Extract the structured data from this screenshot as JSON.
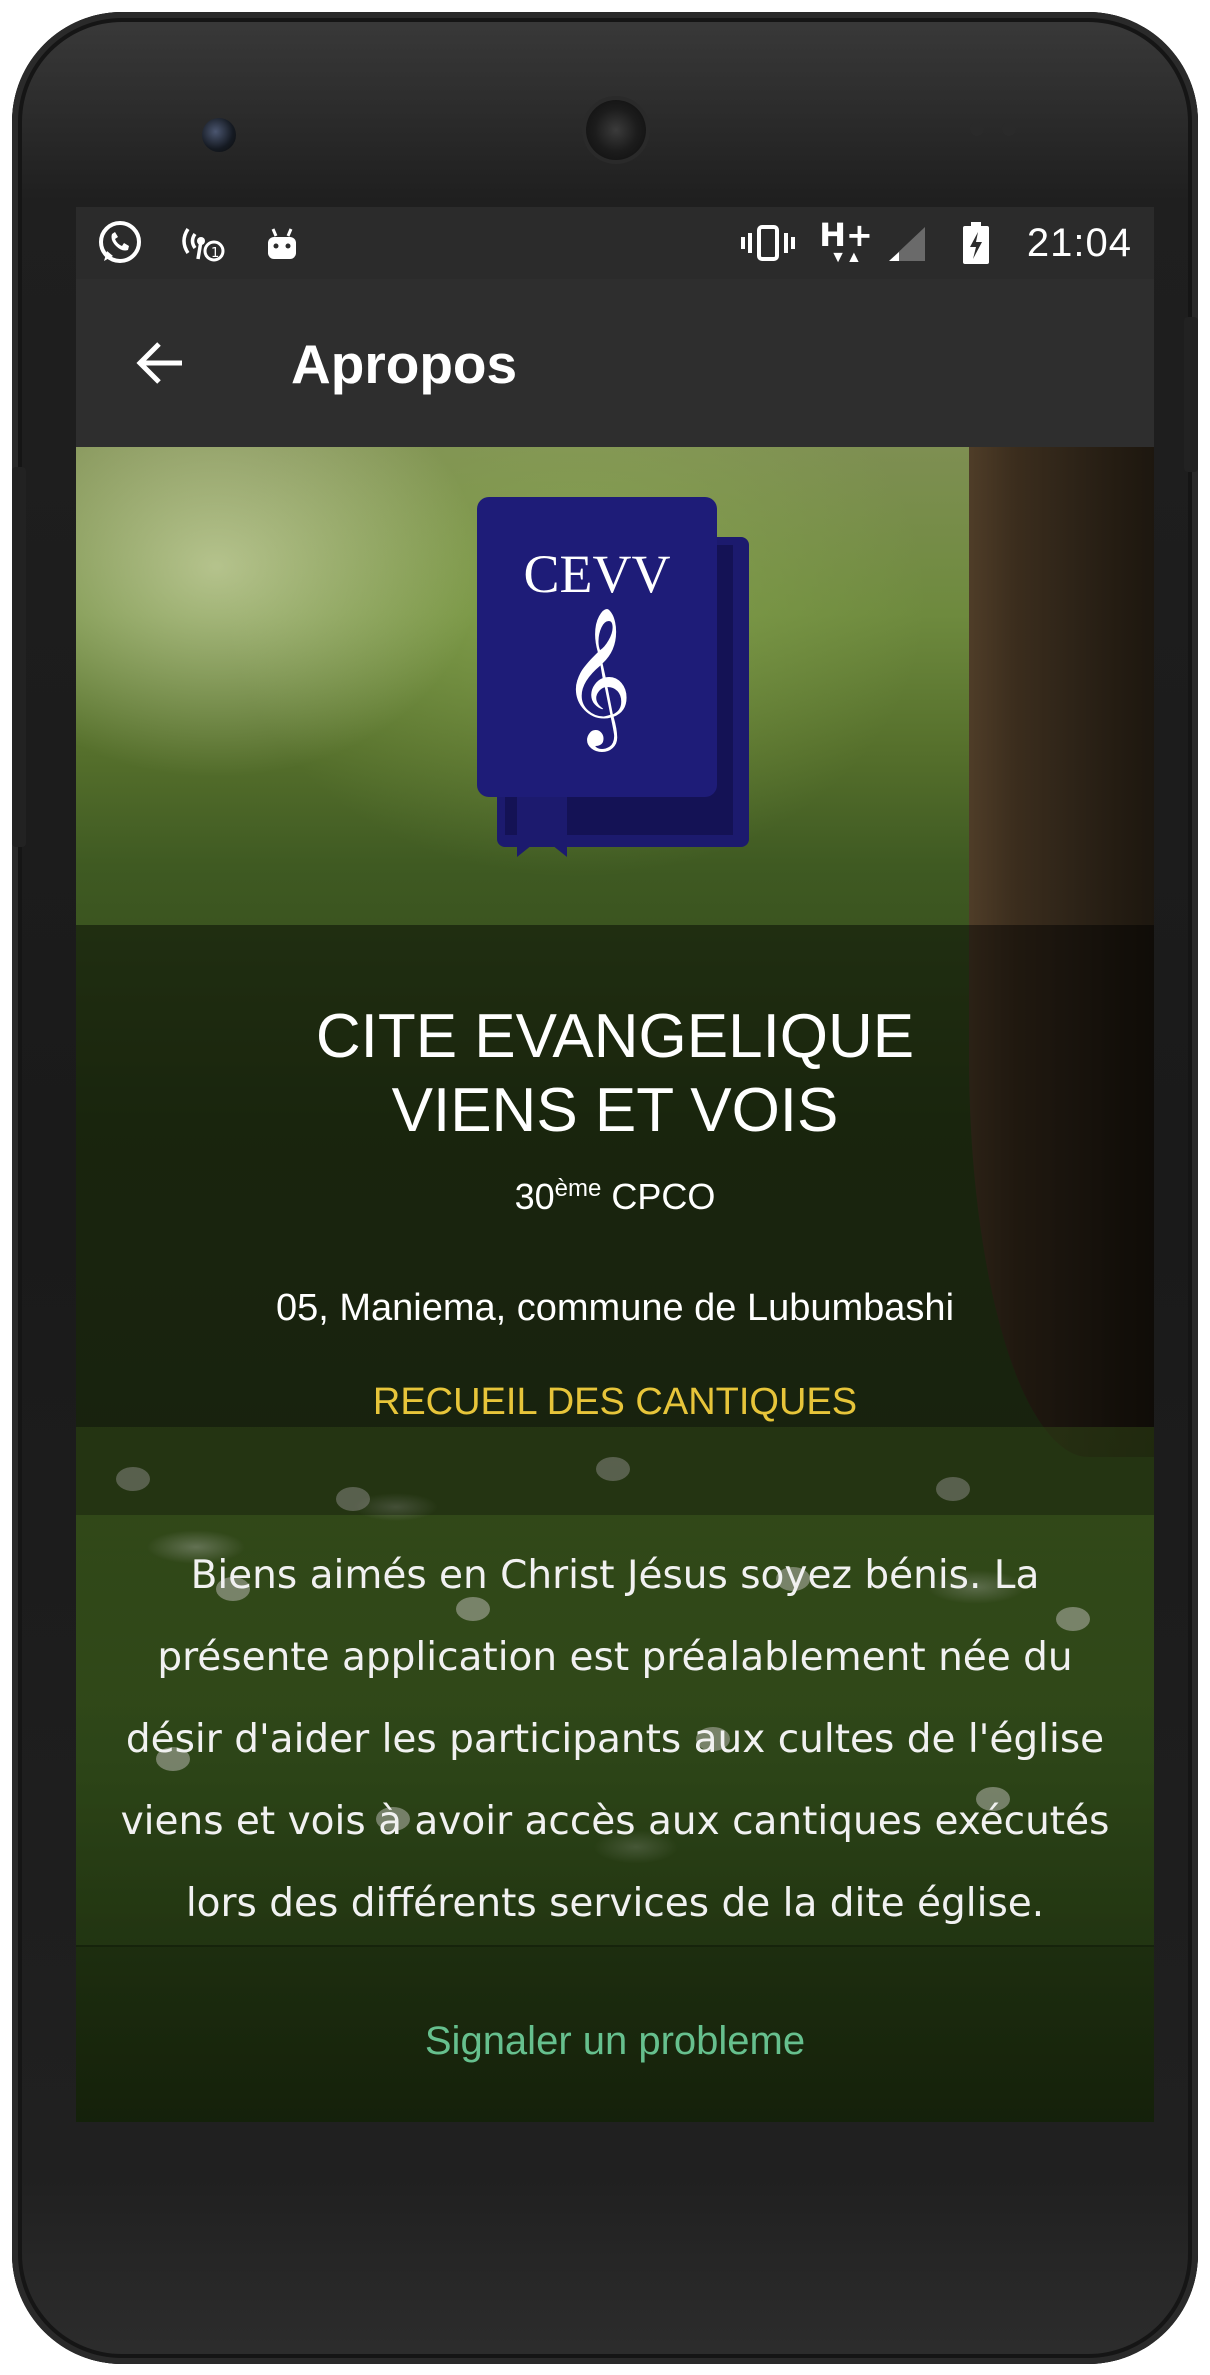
{
  "status_bar": {
    "time": "21:04",
    "network": "H+",
    "icons": [
      "whatsapp-icon",
      "hotspot-icon",
      "android-icon",
      "vibrate-icon",
      "network-hplus-icon",
      "signal-icon",
      "battery-charging-icon"
    ]
  },
  "app_bar": {
    "title": "Apropos",
    "back_icon": "arrow-left-icon"
  },
  "logo": {
    "text": "CEVV",
    "icon": "treble-clef-icon",
    "color": "#1c1a6e"
  },
  "org": {
    "title": "CITE EVANGELIQUE\nVIENS ET VOIS",
    "sub_number": "30",
    "sub_superscript": "ème",
    "sub_suffix": " CPCO",
    "address": "05, Maniema, commune de Lubumbashi",
    "link": "RECUEIL DES CANTIQUES"
  },
  "description": "Biens aimés en Christ Jésus soyez bénis. La présente application est préalablement née du désir d'aider les participants aux cultes de l'église viens et vois à avoir accès aux cantiques exécutés lors des différents services de la dite église.",
  "report": {
    "label": "Signaler un probleme"
  },
  "colors": {
    "link_yellow": "#e7c53a",
    "report_green": "#66c08e",
    "appbar": "#2e2e2e",
    "statusbar": "#2b2b2b"
  }
}
